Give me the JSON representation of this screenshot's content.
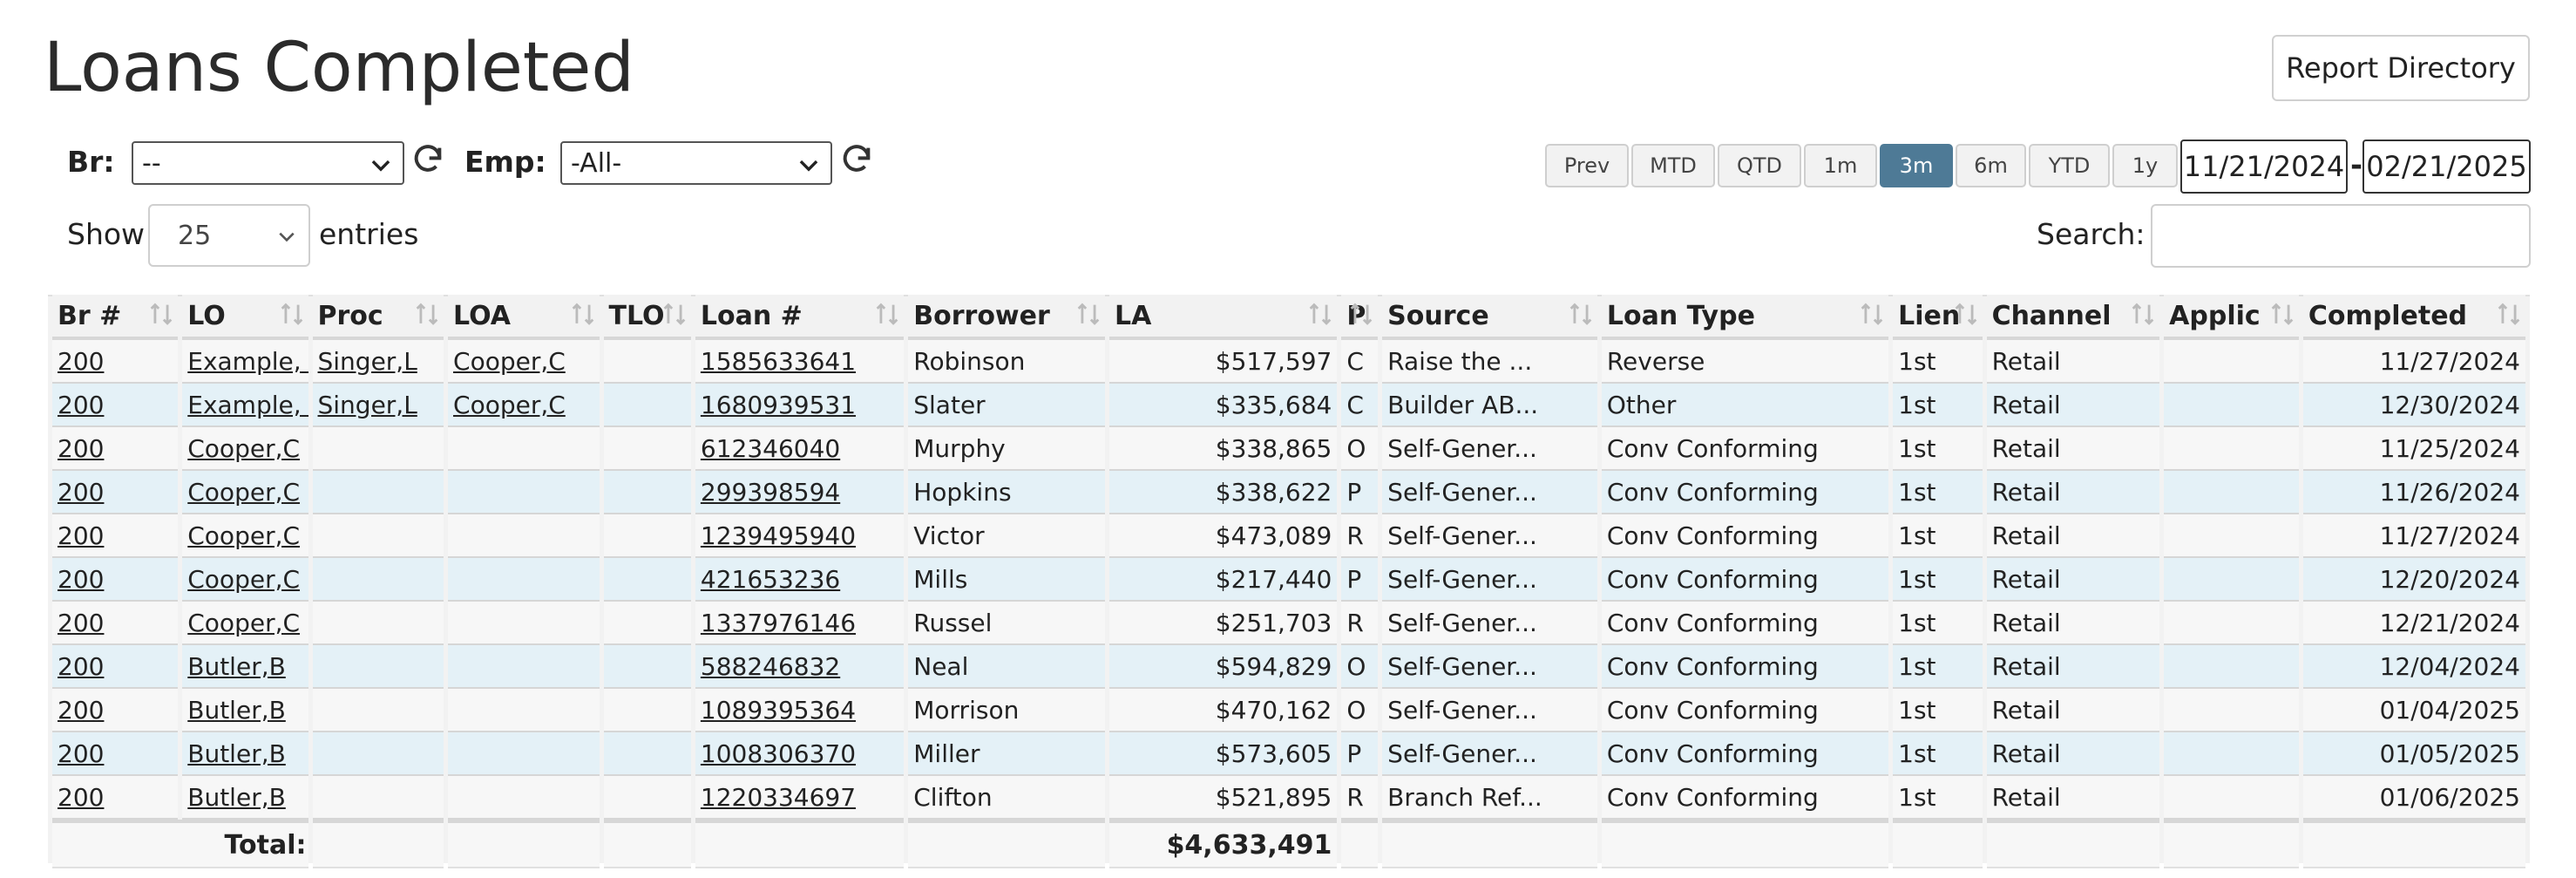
{
  "page": {
    "title": "Loans Completed",
    "report_button": "Report Directory"
  },
  "filters": {
    "branch_label": "Br:",
    "branch_value": "--",
    "employee_label": "Emp:",
    "employee_value": "-All-"
  },
  "periods": [
    "Prev",
    "MTD",
    "QTD",
    "1m",
    "3m",
    "6m",
    "YTD",
    "1y"
  ],
  "active_period": "3m",
  "date_range": {
    "start": "11/21/2024",
    "separator": "-",
    "end": "02/21/2025"
  },
  "length_control": {
    "show_label": "Show",
    "value": "25",
    "entries_label": "entries"
  },
  "search": {
    "label": "Search:",
    "value": ""
  },
  "table": {
    "columns": [
      "Br #",
      "LO",
      "Proc",
      "LOA",
      "TLO",
      "Loan #",
      "Borrower",
      "LA",
      "P",
      "Source",
      "Loan Type",
      "Lien",
      "Channel",
      "Applic",
      "Completed"
    ],
    "rows": [
      {
        "br": "200",
        "lo": "Example, A",
        "proc": "Singer,L",
        "loa": "Cooper,C",
        "tlo": "",
        "loan": "1585633641",
        "borrower": "Robinson",
        "la": "$517,597",
        "p": "C",
        "source": "Raise the ...",
        "type": "Reverse",
        "lien": "1st",
        "channel": "Retail",
        "applic": "",
        "completed": "11/27/2024"
      },
      {
        "br": "200",
        "lo": "Example, A",
        "proc": "Singer,L",
        "loa": "Cooper,C",
        "tlo": "",
        "loan": "1680939531",
        "borrower": "Slater",
        "la": "$335,684",
        "p": "C",
        "source": "Builder AB...",
        "type": "Other",
        "lien": "1st",
        "channel": "Retail",
        "applic": "",
        "completed": "12/30/2024"
      },
      {
        "br": "200",
        "lo": "Cooper,C",
        "proc": "",
        "loa": "",
        "tlo": "",
        "loan": "612346040",
        "borrower": "Murphy",
        "la": "$338,865",
        "p": "O",
        "source": "Self-Gener...",
        "type": "Conv Conforming",
        "lien": "1st",
        "channel": "Retail",
        "applic": "",
        "completed": "11/25/2024"
      },
      {
        "br": "200",
        "lo": "Cooper,C",
        "proc": "",
        "loa": "",
        "tlo": "",
        "loan": "299398594",
        "borrower": "Hopkins",
        "la": "$338,622",
        "p": "P",
        "source": "Self-Gener...",
        "type": "Conv Conforming",
        "lien": "1st",
        "channel": "Retail",
        "applic": "",
        "completed": "11/26/2024"
      },
      {
        "br": "200",
        "lo": "Cooper,C",
        "proc": "",
        "loa": "",
        "tlo": "",
        "loan": "1239495940",
        "borrower": "Victor",
        "la": "$473,089",
        "p": "R",
        "source": "Self-Gener...",
        "type": "Conv Conforming",
        "lien": "1st",
        "channel": "Retail",
        "applic": "",
        "completed": "11/27/2024"
      },
      {
        "br": "200",
        "lo": "Cooper,C",
        "proc": "",
        "loa": "",
        "tlo": "",
        "loan": "421653236",
        "borrower": "Mills",
        "la": "$217,440",
        "p": "P",
        "source": "Self-Gener...",
        "type": "Conv Conforming",
        "lien": "1st",
        "channel": "Retail",
        "applic": "",
        "completed": "12/20/2024"
      },
      {
        "br": "200",
        "lo": "Cooper,C",
        "proc": "",
        "loa": "",
        "tlo": "",
        "loan": "1337976146",
        "borrower": "Russel",
        "la": "$251,703",
        "p": "R",
        "source": "Self-Gener...",
        "type": "Conv Conforming",
        "lien": "1st",
        "channel": "Retail",
        "applic": "",
        "completed": "12/21/2024"
      },
      {
        "br": "200",
        "lo": "Butler,B",
        "proc": "",
        "loa": "",
        "tlo": "",
        "loan": "588246832",
        "borrower": "Neal",
        "la": "$594,829",
        "p": "O",
        "source": "Self-Gener...",
        "type": "Conv Conforming",
        "lien": "1st",
        "channel": "Retail",
        "applic": "",
        "completed": "12/04/2024"
      },
      {
        "br": "200",
        "lo": "Butler,B",
        "proc": "",
        "loa": "",
        "tlo": "",
        "loan": "1089395364",
        "borrower": "Morrison",
        "la": "$470,162",
        "p": "O",
        "source": "Self-Gener...",
        "type": "Conv Conforming",
        "lien": "1st",
        "channel": "Retail",
        "applic": "",
        "completed": "01/04/2025"
      },
      {
        "br": "200",
        "lo": "Butler,B",
        "proc": "",
        "loa": "",
        "tlo": "",
        "loan": "1008306370",
        "borrower": "Miller",
        "la": "$573,605",
        "p": "P",
        "source": "Self-Gener...",
        "type": "Conv Conforming",
        "lien": "1st",
        "channel": "Retail",
        "applic": "",
        "completed": "01/05/2025"
      },
      {
        "br": "200",
        "lo": "Butler,B",
        "proc": "",
        "loa": "",
        "tlo": "",
        "loan": "1220334697",
        "borrower": "Clifton",
        "la": "$521,895",
        "p": "R",
        "source": "Branch Ref...",
        "type": "Conv Conforming",
        "lien": "1st",
        "channel": "Retail",
        "applic": "",
        "completed": "01/06/2025"
      }
    ],
    "total_label": "Total:",
    "total_la": "$4,633,491"
  },
  "icons": {
    "refresh": "refresh-icon",
    "chevron": "chevron-down-icon",
    "sort": "sort-icon"
  },
  "colors": {
    "active_period": "#4e7a96",
    "row_even": "#e4f1f7",
    "row_odd": "#f7f7f7"
  }
}
